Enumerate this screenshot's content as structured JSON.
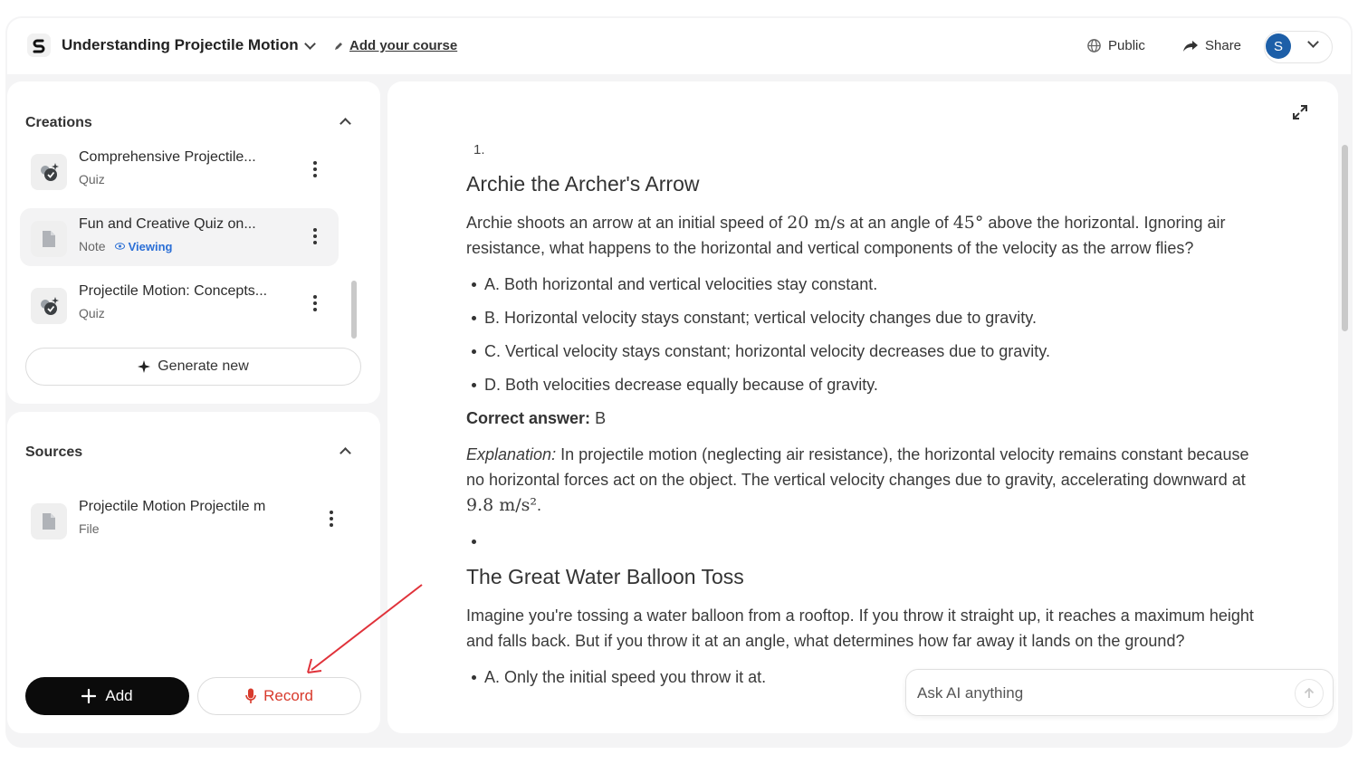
{
  "header": {
    "course_title": "Understanding Projectile Motion",
    "add_course_label": "Add your course",
    "public_label": "Public",
    "share_label": "Share",
    "avatar_initial": "S"
  },
  "creations": {
    "title": "Creations",
    "items": [
      {
        "name": "Comprehensive Projectile...",
        "type": "Quiz",
        "icon": "quiz-icon"
      },
      {
        "name": "Fun and Creative Quiz on...",
        "type": "Note",
        "icon": "note-icon",
        "status": "Viewing"
      },
      {
        "name": "Projectile Motion: Concepts...",
        "type": "Quiz",
        "icon": "quiz-icon"
      }
    ],
    "generate_label": "Generate new"
  },
  "sources": {
    "title": "Sources",
    "items": [
      {
        "name": "Projectile Motion Projectile m",
        "type": "File",
        "icon": "file-icon"
      }
    ]
  },
  "actions": {
    "add_label": "Add",
    "record_label": "Record"
  },
  "content": {
    "q1": {
      "number": "1.",
      "title": "Archie the Archer's Arrow",
      "prompt_before": "Archie shoots an arrow at an initial speed of ",
      "speed_math": "20 m/s",
      "prompt_mid": " at an angle of ",
      "angle_math": "45°",
      "prompt_after": " above the horizontal. Ignoring air resistance, what happens to the horizontal and vertical components of the velocity as the arrow flies?",
      "options": [
        "A. Both horizontal and vertical velocities stay constant.",
        "B. Horizontal velocity stays constant; vertical velocity changes due to gravity.",
        "C. Vertical velocity stays constant; horizontal velocity decreases due to gravity.",
        "D. Both velocities decrease equally because of gravity."
      ],
      "correct_label": "Correct answer:",
      "correct_value": "B",
      "explanation_label": "Explanation:",
      "explanation_text": " In projectile motion (neglecting air resistance), the horizontal velocity remains constant because no horizontal forces act on the object. The vertical velocity changes due to gravity, accelerating downward at ",
      "gravity_math": "9.8 m/s²",
      "explanation_end": "."
    },
    "q2": {
      "title": "The Great Water Balloon Toss",
      "prompt": "Imagine you're tossing a water balloon from a rooftop. If you throw it straight up, it reaches a maximum height and falls back. But if you throw it at an angle, what determines how far away it lands on the ground?",
      "options": [
        "A. Only the initial speed you throw it at."
      ]
    }
  },
  "ask": {
    "placeholder": "Ask AI anything"
  },
  "colors": {
    "accent_blue": "#2b6fd6",
    "record_red": "#d83a2c",
    "avatar_blue": "#1d5fa8",
    "annotation_arrow": "#e0323a"
  }
}
